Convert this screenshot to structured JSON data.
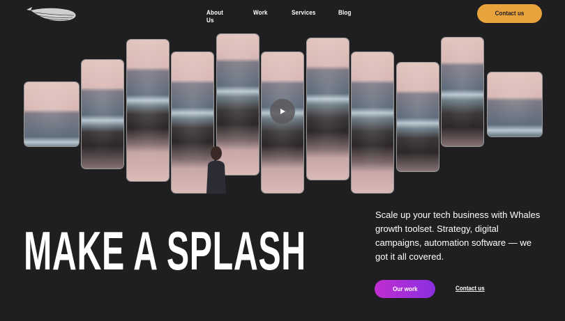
{
  "header": {
    "logo": "whale-logo-icon",
    "nav": [
      "About Us",
      "Work",
      "Services",
      "Blog"
    ],
    "cta": "Contact us"
  },
  "hero": {
    "video": "play-icon",
    "headline": "MAKE A SPLASH",
    "description": "Scale up your tech business with Whales growth toolset. Strategy, digital campaigns, automation software — we got it all covered.",
    "primary_button": "Our work",
    "secondary_link": "Contact us"
  },
  "colors": {
    "background": "#1f1e21",
    "accent": "#e8a33d",
    "gradient_start": "#c02ed0",
    "gradient_end": "#8b2fe0"
  }
}
